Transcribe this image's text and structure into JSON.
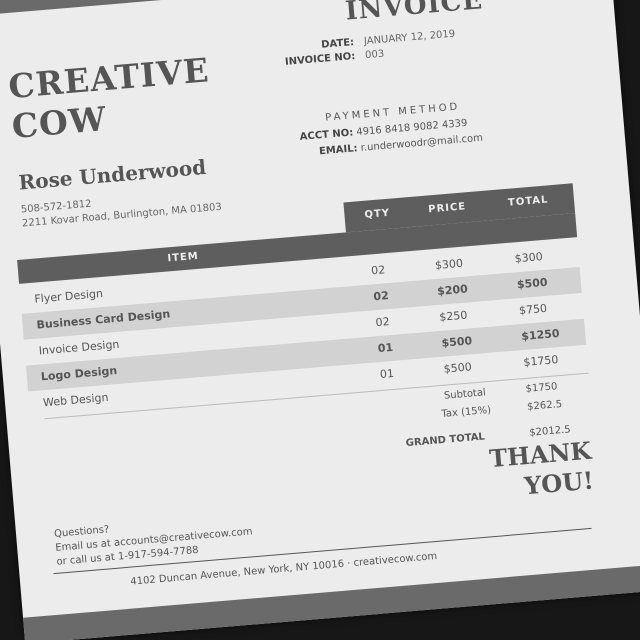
{
  "brand": {
    "line1": "CREATIVE",
    "line2": "COW"
  },
  "invoice": {
    "title": "INVOICE",
    "date_label": "DATE:",
    "date_value": "JANUARY 12, 2019",
    "number_label": "INVOICE NO:",
    "number_value": "003"
  },
  "payment": {
    "title": "PAYMENT METHOD",
    "acct_label": "ACCT NO:",
    "acct_value": "4916 8418 9082 4339",
    "email_label": "EMAIL:",
    "email_value": "r.underwoodr@mail.com"
  },
  "client": {
    "name": "Rose Underwood",
    "phone": "508-572-1812",
    "address": "2211 Kovar Road, Burlington, MA 01803"
  },
  "table": {
    "headers": {
      "item": "ITEM",
      "qty": "QTY",
      "price": "PRICE",
      "total": "TOTAL"
    },
    "rows": [
      {
        "item": "Flyer Design",
        "qty": "02",
        "price": "$300",
        "total": "$300",
        "shaded": false
      },
      {
        "item": "Business Card Design",
        "qty": "02",
        "price": "$200",
        "total": "$500",
        "shaded": true
      },
      {
        "item": "Invoice Design",
        "qty": "02",
        "price": "$250",
        "total": "$750",
        "shaded": false
      },
      {
        "item": "Logo Design",
        "qty": "01",
        "price": "$500",
        "total": "$1250",
        "shaded": true
      },
      {
        "item": "Web Design",
        "qty": "01",
        "price": "$500",
        "total": "$1750",
        "shaded": false
      }
    ]
  },
  "summary": {
    "subtotal_label": "Subtotal",
    "subtotal_value": "$1750",
    "tax_label": "Tax (15%)",
    "tax_value": "$262.5",
    "grand_label": "GRAND TOTAL",
    "grand_value": "$2012.5"
  },
  "thanks": {
    "line1": "THANK",
    "line2": "YOU!"
  },
  "contact": {
    "line1": "Questions?",
    "line2": "Email us at accounts@creativecow.com",
    "line3": "or call us at 1-917-594-7788"
  },
  "footer": {
    "address": "4102 Duncan Avenue, New York, NY 10016 · creativecow.com"
  }
}
